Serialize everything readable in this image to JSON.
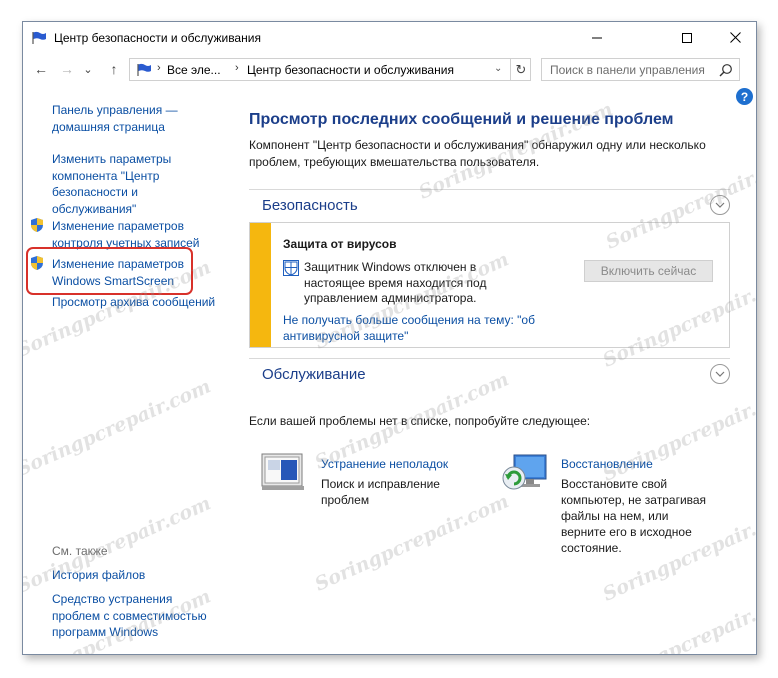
{
  "window": {
    "title": "Центр безопасности и обслуживания",
    "controls": {
      "minimize": "—",
      "maximize": "☐",
      "close": "✕"
    }
  },
  "nav": {
    "back": "←",
    "forward": "→",
    "dropdown": "⌄",
    "up": "↑",
    "breadcrumb": [
      "Все эле...",
      "Центр безопасности и обслуживания"
    ],
    "separator": "›",
    "refresh": "↻",
    "search_placeholder": "Поиск в панели управления"
  },
  "help": "?",
  "sidebar": {
    "home_link": "Панель управления — домашняя страница",
    "items": [
      {
        "label": "Изменить параметры компонента \"Центр безопасности и обслуживания\"",
        "icon": null
      },
      {
        "label": "Изменение параметров контроля учетных записей",
        "icon": "uac-shield-icon"
      },
      {
        "label": "Изменение параметров Windows SmartScreen",
        "icon": "uac-shield-icon",
        "highlighted": true
      },
      {
        "label": "Просмотр архива сообщений",
        "icon": null
      }
    ],
    "see_also_heading": "См. также",
    "see_also": [
      "История файлов",
      "Средство устранения проблем с совместимостью программ Windows"
    ]
  },
  "main": {
    "title": "Просмотр последних сообщений и решение проблем",
    "description": "Компонент \"Центр безопасности и обслуживания\" обнаружил одну или несколько проблем, требующих вмешательства пользователя.",
    "security": {
      "title": "Безопасность",
      "alert_title": "Защита от вирусов",
      "alert_message": "Защитник Windows отключен в настоящее время находится под управлением администратора.",
      "alert_button": "Включить сейчас",
      "alert_link": "Не получать больше сообщения на тему: \"об антивирусной защите\"",
      "alert_color": "#f5b70f"
    },
    "maintenance": {
      "title": "Обслуживание"
    },
    "suggestion": "Если вашей проблемы нет в списке, попробуйте следующее:",
    "tools": [
      {
        "title": "Устранение неполадок",
        "description": "Поиск и исправление проблем",
        "icon": "troubleshoot-icon"
      },
      {
        "title": "Восстановление",
        "description": "Восстановите свой компьютер, не затрагивая файлы на нем, или верните его в исходное состояние.",
        "icon": "recovery-icon"
      }
    ]
  },
  "watermark": "Soringpcrepair.com"
}
